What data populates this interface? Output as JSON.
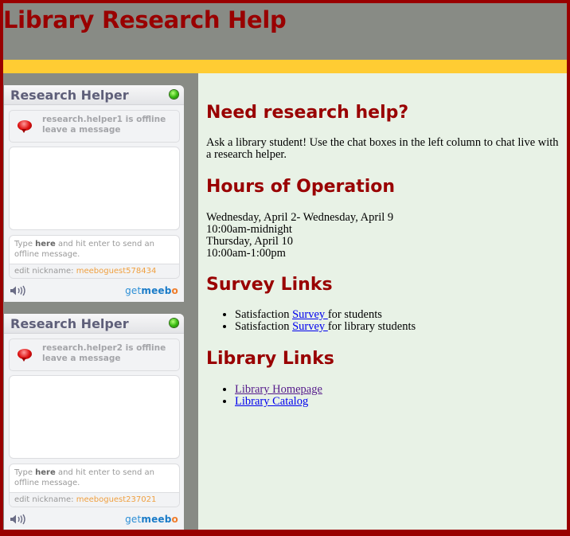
{
  "header": {
    "title": "Library Research Help"
  },
  "colors": {
    "brand_red": "#990000",
    "accent_yellow": "#FFCC33",
    "header_gray": "#888B85",
    "content_bg": "#E8F2E6",
    "link": "#0000EE",
    "visited_link": "#551A8B"
  },
  "sidebar": {
    "widgets": [
      {
        "title": "Research Helper",
        "status_icon": "online-indicator-icon",
        "status_line1": "research.helper1 is offline",
        "status_line2": "leave a message",
        "input_hint_pre": "Type ",
        "input_hint_bold": "here",
        "input_hint_post": " and hit enter to send an offline message.",
        "nickname_label": "edit nickname: ",
        "nickname_value": "meeboguest578434",
        "brand_get": "get",
        "brand_meeb": "meeb",
        "brand_o": "o"
      },
      {
        "title": "Research Helper",
        "status_icon": "online-indicator-icon",
        "status_line1": "research.helper2 is offline",
        "status_line2": "leave a message",
        "input_hint_pre": "Type ",
        "input_hint_bold": "here",
        "input_hint_post": " and hit enter to send an offline message.",
        "nickname_label": "edit nickname: ",
        "nickname_value": "meeboguest237021",
        "brand_get": "get",
        "brand_meeb": "meeb",
        "brand_o": "o"
      }
    ]
  },
  "main": {
    "need_heading": "Need research help?",
    "need_text": "Ask a library student! Use the chat boxes in the left column to chat live with a research helper.",
    "hours_heading": "Hours of Operation",
    "hours": [
      "Wednesday, April 2- Wednesday, April 9",
      "10:00am-midnight",
      "Thursday, April 10",
      "10:00am-1:00pm"
    ],
    "survey_heading": "Survey Links",
    "survey_items": [
      {
        "pre": "Satisfaction ",
        "link": "Survey ",
        "post": "for students"
      },
      {
        "pre": "Satisfaction ",
        "link": "Survey ",
        "post": "for library students"
      }
    ],
    "library_heading": "Library Links",
    "library_links": [
      {
        "label": "Library Homepage",
        "visited": true
      },
      {
        "label": "Library Catalog",
        "visited": false
      }
    ]
  }
}
